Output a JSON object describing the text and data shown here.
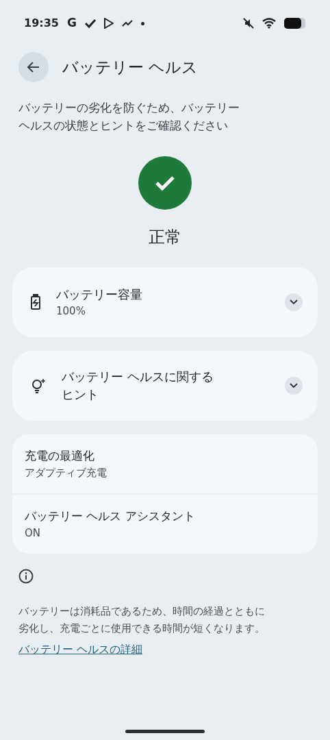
{
  "status_bar": {
    "time": "19:35",
    "app_letter": "G"
  },
  "header": {
    "title": "バッテリー ヘルス"
  },
  "description": "バッテリーの劣化を防ぐため、バッテリーヘルスの状態とヒントをご確認ください",
  "status": {
    "label": "正常"
  },
  "expandable_cards": [
    {
      "kind": "battery",
      "title": "バッテリー容量",
      "subtitle": "100%",
      "expanded": false
    },
    {
      "kind": "tips",
      "title": "バッテリー ヘルスに関するヒント",
      "expanded": false
    }
  ],
  "settings": [
    {
      "title": "充電の最適化",
      "subtitle": "アダプティブ充電"
    },
    {
      "title": "バッテリー ヘルス アシスタント",
      "subtitle": "ON"
    }
  ],
  "footer": {
    "note": "バッテリーは消耗品であるため、時間の経過とともに劣化し、充電ごとに使用できる時間が短くなります。",
    "link": "バッテリー ヘルスの詳細"
  }
}
